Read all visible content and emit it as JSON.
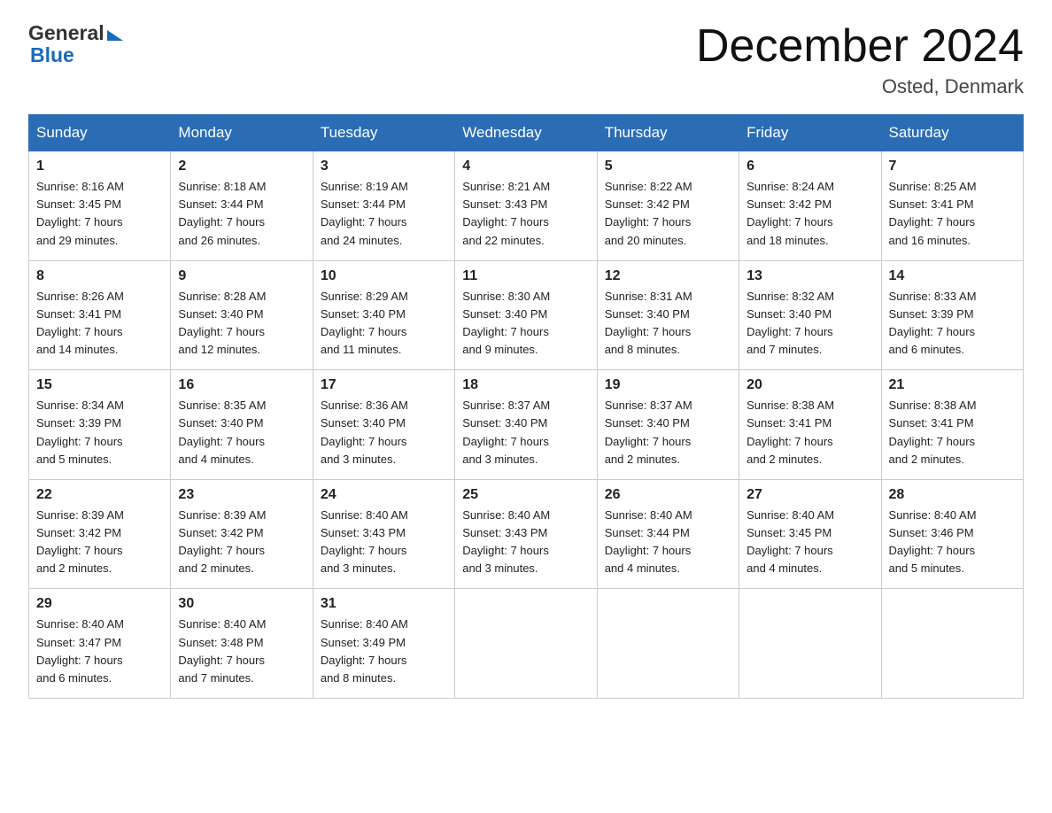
{
  "header": {
    "logo_general": "General",
    "logo_blue": "Blue",
    "month_title": "December 2024",
    "location": "Osted, Denmark"
  },
  "days_of_week": [
    "Sunday",
    "Monday",
    "Tuesday",
    "Wednesday",
    "Thursday",
    "Friday",
    "Saturday"
  ],
  "weeks": [
    [
      {
        "day": "1",
        "sunrise": "8:16 AM",
        "sunset": "3:45 PM",
        "daylight": "7 hours and 29 minutes."
      },
      {
        "day": "2",
        "sunrise": "8:18 AM",
        "sunset": "3:44 PM",
        "daylight": "7 hours and 26 minutes."
      },
      {
        "day": "3",
        "sunrise": "8:19 AM",
        "sunset": "3:44 PM",
        "daylight": "7 hours and 24 minutes."
      },
      {
        "day": "4",
        "sunrise": "8:21 AM",
        "sunset": "3:43 PM",
        "daylight": "7 hours and 22 minutes."
      },
      {
        "day": "5",
        "sunrise": "8:22 AM",
        "sunset": "3:42 PM",
        "daylight": "7 hours and 20 minutes."
      },
      {
        "day": "6",
        "sunrise": "8:24 AM",
        "sunset": "3:42 PM",
        "daylight": "7 hours and 18 minutes."
      },
      {
        "day": "7",
        "sunrise": "8:25 AM",
        "sunset": "3:41 PM",
        "daylight": "7 hours and 16 minutes."
      }
    ],
    [
      {
        "day": "8",
        "sunrise": "8:26 AM",
        "sunset": "3:41 PM",
        "daylight": "7 hours and 14 minutes."
      },
      {
        "day": "9",
        "sunrise": "8:28 AM",
        "sunset": "3:40 PM",
        "daylight": "7 hours and 12 minutes."
      },
      {
        "day": "10",
        "sunrise": "8:29 AM",
        "sunset": "3:40 PM",
        "daylight": "7 hours and 11 minutes."
      },
      {
        "day": "11",
        "sunrise": "8:30 AM",
        "sunset": "3:40 PM",
        "daylight": "7 hours and 9 minutes."
      },
      {
        "day": "12",
        "sunrise": "8:31 AM",
        "sunset": "3:40 PM",
        "daylight": "7 hours and 8 minutes."
      },
      {
        "day": "13",
        "sunrise": "8:32 AM",
        "sunset": "3:40 PM",
        "daylight": "7 hours and 7 minutes."
      },
      {
        "day": "14",
        "sunrise": "8:33 AM",
        "sunset": "3:39 PM",
        "daylight": "7 hours and 6 minutes."
      }
    ],
    [
      {
        "day": "15",
        "sunrise": "8:34 AM",
        "sunset": "3:39 PM",
        "daylight": "7 hours and 5 minutes."
      },
      {
        "day": "16",
        "sunrise": "8:35 AM",
        "sunset": "3:40 PM",
        "daylight": "7 hours and 4 minutes."
      },
      {
        "day": "17",
        "sunrise": "8:36 AM",
        "sunset": "3:40 PM",
        "daylight": "7 hours and 3 minutes."
      },
      {
        "day": "18",
        "sunrise": "8:37 AM",
        "sunset": "3:40 PM",
        "daylight": "7 hours and 3 minutes."
      },
      {
        "day": "19",
        "sunrise": "8:37 AM",
        "sunset": "3:40 PM",
        "daylight": "7 hours and 2 minutes."
      },
      {
        "day": "20",
        "sunrise": "8:38 AM",
        "sunset": "3:41 PM",
        "daylight": "7 hours and 2 minutes."
      },
      {
        "day": "21",
        "sunrise": "8:38 AM",
        "sunset": "3:41 PM",
        "daylight": "7 hours and 2 minutes."
      }
    ],
    [
      {
        "day": "22",
        "sunrise": "8:39 AM",
        "sunset": "3:42 PM",
        "daylight": "7 hours and 2 minutes."
      },
      {
        "day": "23",
        "sunrise": "8:39 AM",
        "sunset": "3:42 PM",
        "daylight": "7 hours and 2 minutes."
      },
      {
        "day": "24",
        "sunrise": "8:40 AM",
        "sunset": "3:43 PM",
        "daylight": "7 hours and 3 minutes."
      },
      {
        "day": "25",
        "sunrise": "8:40 AM",
        "sunset": "3:43 PM",
        "daylight": "7 hours and 3 minutes."
      },
      {
        "day": "26",
        "sunrise": "8:40 AM",
        "sunset": "3:44 PM",
        "daylight": "7 hours and 4 minutes."
      },
      {
        "day": "27",
        "sunrise": "8:40 AM",
        "sunset": "3:45 PM",
        "daylight": "7 hours and 4 minutes."
      },
      {
        "day": "28",
        "sunrise": "8:40 AM",
        "sunset": "3:46 PM",
        "daylight": "7 hours and 5 minutes."
      }
    ],
    [
      {
        "day": "29",
        "sunrise": "8:40 AM",
        "sunset": "3:47 PM",
        "daylight": "7 hours and 6 minutes."
      },
      {
        "day": "30",
        "sunrise": "8:40 AM",
        "sunset": "3:48 PM",
        "daylight": "7 hours and 7 minutes."
      },
      {
        "day": "31",
        "sunrise": "8:40 AM",
        "sunset": "3:49 PM",
        "daylight": "7 hours and 8 minutes."
      },
      null,
      null,
      null,
      null
    ]
  ],
  "labels": {
    "sunrise_label": "Sunrise:",
    "sunset_label": "Sunset:",
    "daylight_label": "Daylight:"
  }
}
